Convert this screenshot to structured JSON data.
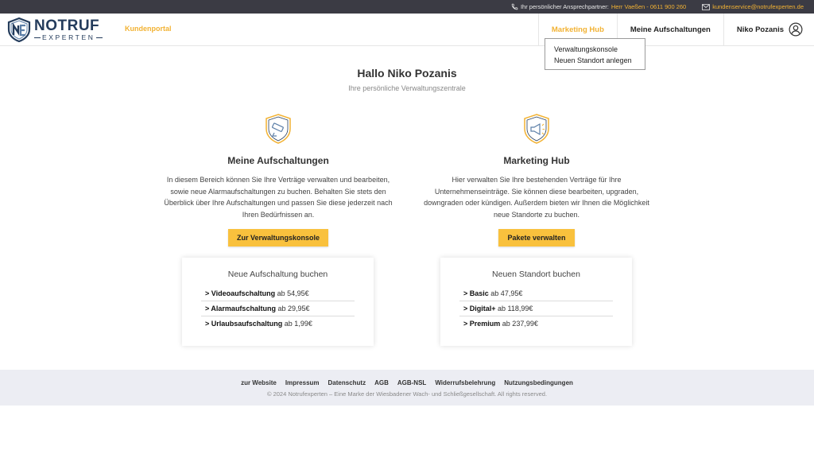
{
  "topbar": {
    "contact_label": "Ihr persönlicher Ansprechpartner:",
    "contact_name_phone": "Herr Vaeßen - 0611 900 260",
    "email": "kundenservice@notrufexperten.de"
  },
  "header": {
    "logo_line1": "NOTRUF",
    "logo_line2": "EXPERTEN",
    "portal_label": "Kundenportal",
    "nav": [
      {
        "label": "Marketing Hub"
      },
      {
        "label": "Meine Aufschaltungen"
      },
      {
        "label": "Niko Pozanis"
      }
    ]
  },
  "dropdown": {
    "items": [
      {
        "label": "Verwaltungskonsole"
      },
      {
        "label": "Neuen Standort anlegen"
      }
    ]
  },
  "hero": {
    "title": "Hallo Niko Pozanis",
    "subtitle": "Ihre persönliche Verwaltungszentrale"
  },
  "sections": [
    {
      "title": "Meine Aufschaltungen",
      "text": "In diesem Bereich können Sie Ihre Verträge verwalten und bearbeiten, sowie neue Alarmaufschaltungen zu buchen. Behalten Sie stets den Überblick über Ihre Aufschaltungen und passen Sie diese jederzeit nach Ihren Bedürfnissen an.",
      "button": "Zur Verwaltungskonsole",
      "icon": "camera-shield-icon"
    },
    {
      "title": "Marketing Hub",
      "text": "Hier verwalten Sie Ihre bestehenden Verträge für Ihre Unternehmenseinträge. Sie können diese bearbeiten, upgraden, downgraden oder kündigen. Außerdem bieten wir Ihnen die Möglichkeit neue Standorte zu buchen.",
      "button": "Pakete verwalten",
      "icon": "megaphone-shield-icon"
    }
  ],
  "cards": [
    {
      "title": "Neue Aufschaltung buchen",
      "items": [
        {
          "name": "> Videoaufschaltung",
          "price": "ab 54,95€"
        },
        {
          "name": "> Alarmaufschaltung",
          "price": "ab 29,95€"
        },
        {
          "name": "> Urlaubsaufschaltung",
          "price": "ab 1,99€"
        }
      ]
    },
    {
      "title": "Neuen Standort buchen",
      "items": [
        {
          "name": "> Basic",
          "price": "ab 47,95€"
        },
        {
          "name": "> Digital+",
          "price": "ab 118,99€"
        },
        {
          "name": "> Premium",
          "price": "ab 237,99€"
        }
      ]
    }
  ],
  "footer": {
    "links": [
      "zur Website",
      "Impressum",
      "Datenschutz",
      "AGB",
      "AGB-NSL",
      "Widerrufsbelehrung",
      "Nutzungsbedingungen"
    ],
    "copyright": "© 2024 Notrufexperten – Eine Marke der Wiesbadener Wach- und Schließgesellschaft. All rights reserved."
  },
  "colors": {
    "accent": "#f2b233",
    "button": "#f9c13d",
    "topbar": "#3b3b44",
    "brand": "#243c5c",
    "footer_bg": "#ecedf3"
  }
}
